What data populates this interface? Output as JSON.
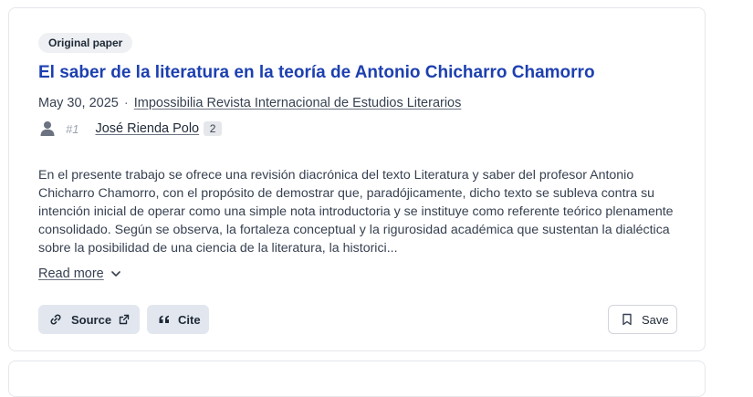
{
  "article": {
    "badge": "Original paper",
    "title": "El saber de la literatura en la teoría de Antonio Chicharro Chamorro",
    "date": "May 30, 2025",
    "separator": "·",
    "journal": "Impossibilia Revista Internacional de Estudios Literarios",
    "author_rank": "#1",
    "author_name": "José Rienda Polo",
    "author_count": "2",
    "abstract": "En el presente trabajo se ofrece una revisión diacrónica del texto Literatura y saber del profesor Antonio Chicharro Chamorro, con el propósito de demostrar que, paradójicamente, dicho texto se subleva contra su intención inicial de operar como una simple nota introductoria y se instituye como referente teórico plenamente consolidado. Según se observa, la fortaleza conceptual y la rigurosidad académica que sustentan la dialéctica sobre la posibilidad de una ciencia de la literatura, la historici...",
    "read_more_label": "Read more"
  },
  "actions": {
    "source_label": "Source",
    "cite_label": "Cite",
    "save_label": "Save"
  },
  "icons": {
    "author": "person-icon",
    "read_more": "chevron-down-icon",
    "source": "link-icon",
    "source_external": "external-link-icon",
    "cite": "quote-icon",
    "save": "bookmark-icon"
  },
  "colors": {
    "title": "#1d40b0",
    "button_bg": "#e2e7ef",
    "badge_bg": "#eef0f3",
    "border": "#e5e7eb"
  }
}
